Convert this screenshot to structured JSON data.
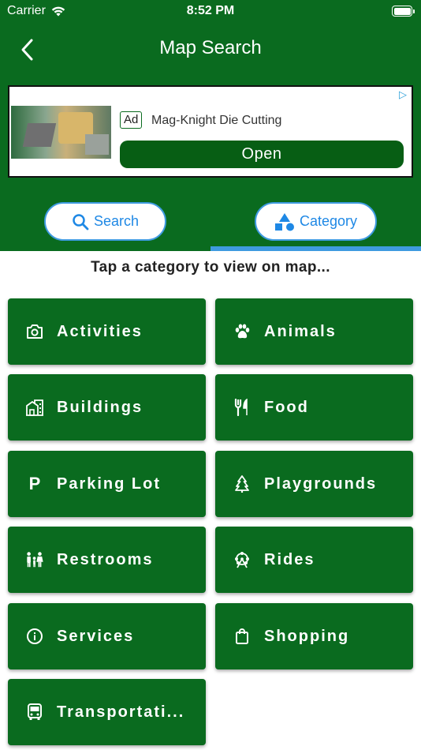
{
  "status_bar": {
    "carrier": "Carrier",
    "time": "8:52 PM"
  },
  "nav": {
    "title": "Map Search"
  },
  "ad": {
    "badge": "Ad",
    "title": "Mag-Knight Die Cutting",
    "button": "Open"
  },
  "tabs": [
    {
      "label": "Search",
      "icon": "search-icon"
    },
    {
      "label": "Category",
      "icon": "shapes-icon"
    }
  ],
  "prompt": "Tap a category to view on map...",
  "categories": [
    {
      "label": "Activities",
      "icon": "camera-icon"
    },
    {
      "label": "Animals",
      "icon": "paw-icon"
    },
    {
      "label": "Buildings",
      "icon": "buildings-icon"
    },
    {
      "label": "Food",
      "icon": "utensils-icon"
    },
    {
      "label": "Parking Lot",
      "icon": "parking-icon"
    },
    {
      "label": "Playgrounds",
      "icon": "tree-icon"
    },
    {
      "label": "Restrooms",
      "icon": "family-icon"
    },
    {
      "label": "Rides",
      "icon": "ferris-wheel-icon"
    },
    {
      "label": "Services",
      "icon": "info-icon"
    },
    {
      "label": "Shopping",
      "icon": "shopping-bag-icon"
    },
    {
      "label": "Transportati...",
      "icon": "bus-icon"
    }
  ],
  "colors": {
    "primary": "#0a6b1f",
    "accent": "#1e88e5",
    "ad_button": "#075e14"
  }
}
